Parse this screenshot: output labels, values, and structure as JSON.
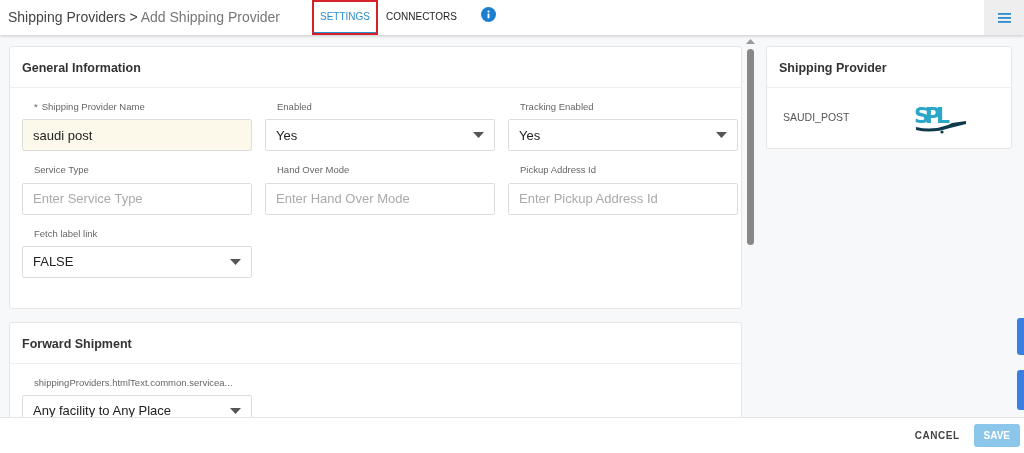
{
  "breadcrumb": {
    "parent": "Shipping Providers",
    "separator": ">",
    "current": "Add Shipping Provider"
  },
  "tabs": [
    {
      "label": "SETTINGS",
      "selected": true,
      "highlighted": true
    },
    {
      "label": "CONNECTORS",
      "selected": false,
      "highlighted": false
    }
  ],
  "sections": [
    {
      "title": "General Information",
      "fields": [
        {
          "kind": "text",
          "required_mark": "*",
          "label": "Shipping Provider Name",
          "value": "saudi post",
          "autofilled": true
        },
        {
          "kind": "select",
          "label": "Enabled",
          "value": "Yes"
        },
        {
          "kind": "select",
          "label": "Tracking Enabled",
          "value": "Yes"
        },
        {
          "kind": "text",
          "label": "Service Type",
          "placeholder": "Enter Service Type",
          "autofilled": false
        },
        {
          "kind": "text",
          "label": "Hand Over Mode",
          "placeholder": "Enter Hand Over Mode",
          "autofilled": false
        },
        {
          "kind": "text",
          "label": "Pickup Address Id",
          "placeholder": "Enter Pickup Address Id",
          "autofilled": false
        },
        {
          "kind": "select",
          "label": "Fetch label link",
          "value": "FALSE"
        }
      ]
    },
    {
      "title": "Forward Shipment",
      "fields": [
        {
          "kind": "select",
          "label": "shippingProviders.htmlText.common.servicea...",
          "value": "Any facility to Any Place"
        }
      ]
    }
  ],
  "side_panel": {
    "title": "Shipping Provider",
    "code": "SAUDI_POST",
    "logo_text": "SPL"
  },
  "footer_buttons": [
    {
      "kind": "text",
      "label": "CANCEL",
      "disabled": false
    },
    {
      "kind": "primary",
      "label": "SAVE",
      "disabled": true
    }
  ]
}
